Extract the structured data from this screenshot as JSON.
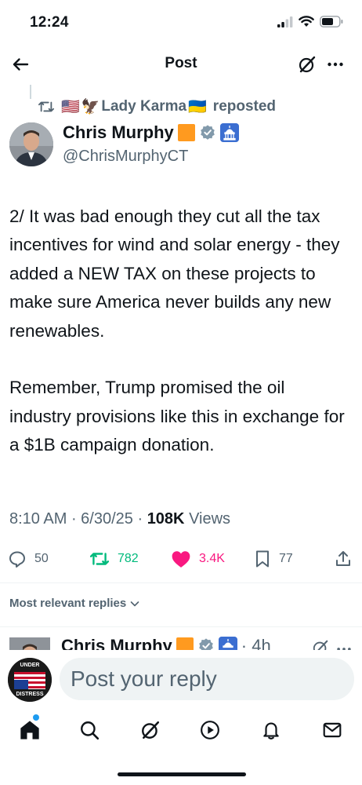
{
  "status_bar": {
    "time": "12:24"
  },
  "header": {
    "title": "Post"
  },
  "repost": {
    "flag_us": "🇺🇸",
    "eagle": "🦅",
    "user": "Lady Karma",
    "flag_ua": "🇺🇦",
    "suffix": "reposted"
  },
  "author": {
    "name": "Chris Murphy",
    "handle": "@ChrisMurphyCT"
  },
  "tweet": {
    "text": "2/ It was bad enough they cut all the tax incentives for wind and solar energy - they added a NEW TAX on these projects to make sure America never builds any new renewables.\n\nRemember, Trump promised the oil industry provisions like this in exchange for a $1B campaign donation.",
    "time": "8:10 AM",
    "date": "6/30/25",
    "views_count": "108K",
    "views_label": "Views"
  },
  "actions": {
    "replies": "50",
    "reposts": "782",
    "likes": "3.4K",
    "bookmarks": "77"
  },
  "replies_section": {
    "label": "Most relevant replies"
  },
  "reply_preview": {
    "name": "Chris Murphy",
    "time": "· 4h"
  },
  "composer": {
    "placeholder": "Post your reply",
    "avatar_text_top": "UNDER",
    "avatar_text_bottom": "DISTRESS"
  },
  "colors": {
    "accent": "#1d9bf0",
    "repost_green": "#00ba7c",
    "like_pink": "#f91880",
    "muted": "#536471",
    "text": "#0f1419"
  }
}
